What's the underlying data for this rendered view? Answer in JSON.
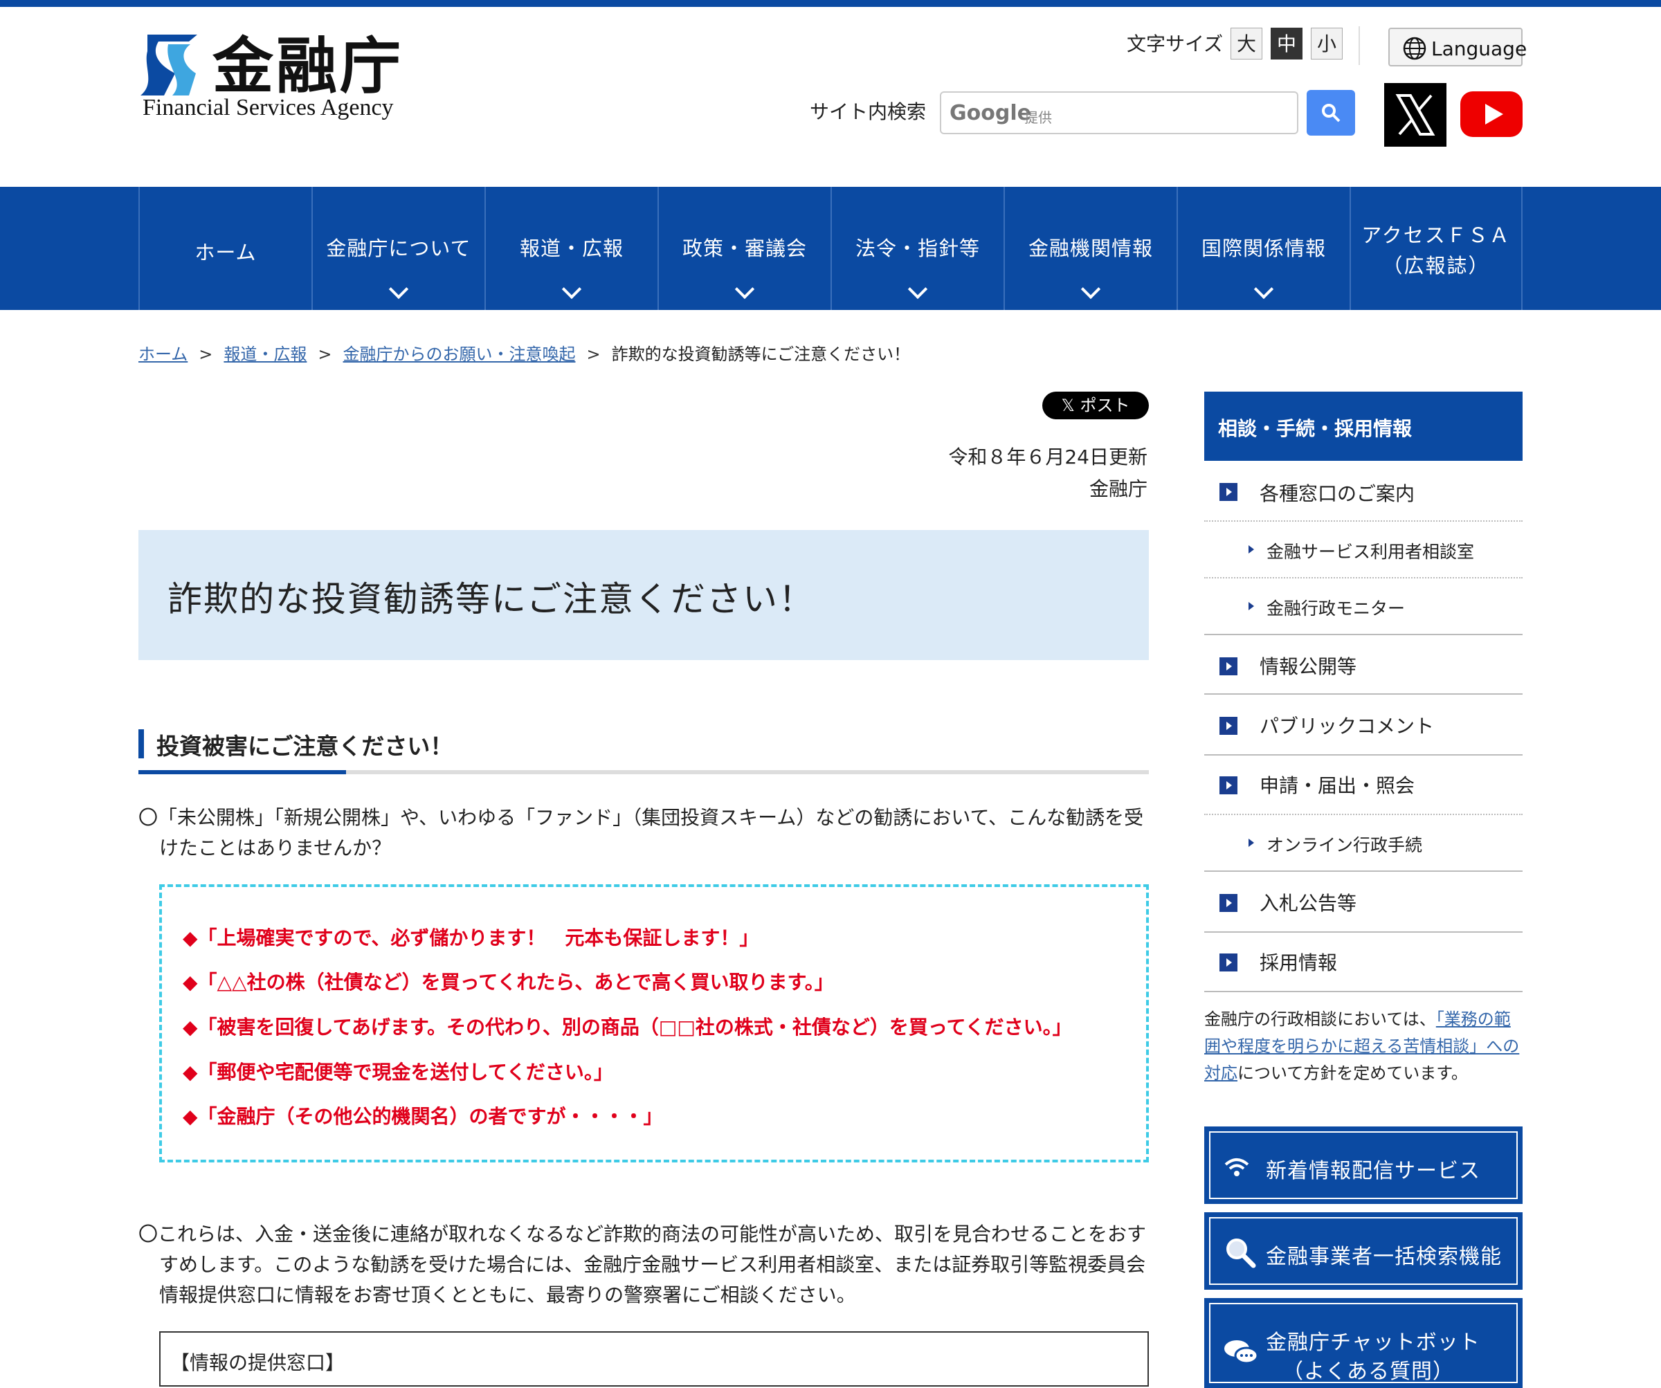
{
  "header": {
    "logo_text": "金融庁",
    "logo_sub": "Financial Services Agency",
    "font_size_label": "文字サイズ",
    "font_sizes": [
      "大",
      "中",
      "小"
    ],
    "active_font_size": "中",
    "language_label": "Language",
    "search_label": "サイト内検索",
    "search_google": "Google",
    "search_provided": "提供",
    "x_icon": "x-logo-icon",
    "youtube_icon": "youtube-icon"
  },
  "nav": [
    {
      "label": "ホーム",
      "has_dropdown": false
    },
    {
      "label": "金融庁について",
      "has_dropdown": true
    },
    {
      "label": "報道・広報",
      "has_dropdown": true
    },
    {
      "label": "政策・審議会",
      "has_dropdown": true
    },
    {
      "label": "法令・指針等",
      "has_dropdown": true
    },
    {
      "label": "金融機関情報",
      "has_dropdown": true
    },
    {
      "label": "国際関係情報",
      "has_dropdown": true
    },
    {
      "label": "アクセスＦＳＡ",
      "label2": "（広報誌）",
      "has_dropdown": false
    }
  ],
  "breadcrumb": [
    "ホーム",
    "報道・広報",
    "金融庁からのお願い・注意喚起",
    "詐欺的な投資勧誘等にご注意ください！"
  ],
  "post_button": "𝕏 ポスト",
  "date": "令和８年６月24日更新",
  "publisher": "金融庁",
  "page_title": "詐欺的な投資勧誘等にご注意ください！",
  "section_heading": "投資被害にご注意ください！",
  "intro_line1": "〇「未公開株」「新規公開株」や、いわゆる「ファンド」（集団投資スキーム）などの勧誘において、こんな勧誘を受",
  "intro_line2": "けたことはありませんか？",
  "warnings": [
    "◆「上場確実ですので、必ず儲かります！　元本も保証します！」",
    "◆「△△社の株（社債など）を買ってくれたら、あとで高く買い取ります。」",
    "◆「被害を回復してあげます。その代わり、別の商品（□□社の株式・社債など）を買ってください。」",
    "◆「郵便や宅配便等で現金を送付してください。」",
    "◆「金融庁（その他公的機関名）の者ですが・・・・」"
  ],
  "advice_line1": "〇これらは、入金・送金後に連絡が取れなくなるなど詐欺的商法の可能性が高いため、取引を見合わせることをおす",
  "advice_line2": "すめします。このような勧誘を受けた場合には、金融庁金融サービス利用者相談室、または証券取引等監視委員会",
  "advice_line3": "情報提供窓口に情報をお寄せ頂くとともに、最寄りの警察署にご相談ください。",
  "info_box_title": "【情報の提供窓口】",
  "sidebar": {
    "heading": "相談・手続・採用情報",
    "items": [
      {
        "label": "各種窓口のご案内",
        "level": 1
      },
      {
        "label": "金融サービス利用者相談室",
        "level": 2
      },
      {
        "label": "金融行政モニター",
        "level": 2
      },
      {
        "label": "情報公開等",
        "level": 1
      },
      {
        "label": "パブリックコメント",
        "level": 1
      },
      {
        "label": "申請・届出・照会",
        "level": 1
      },
      {
        "label": "オンライン行政手続",
        "level": 2
      },
      {
        "label": "入札公告等",
        "level": 1
      },
      {
        "label": "採用情報",
        "level": 1
      }
    ],
    "note_prefix": "金融庁の行政相談においては、",
    "note_link1": "「業務の範",
    "note_link2": "囲や程度を明らかに超える苦情相談」への",
    "note_link3": "対応",
    "note_suffix": "について方針を定めています。",
    "buttons": [
      {
        "label": "新着情報配信サービス",
        "icon": "wifi-icon"
      },
      {
        "label": "金融事業者一括検索機能",
        "icon": "search-icon"
      },
      {
        "label": "金融庁チャットボット",
        "label2": "（よくある質問）",
        "icon": "chat-icon"
      }
    ]
  },
  "colors": {
    "brand_blue": "#0b4aa2",
    "title_bg": "#dbeaf7",
    "warning_red": "#e0001b",
    "dash_border": "#3ecbe6"
  }
}
